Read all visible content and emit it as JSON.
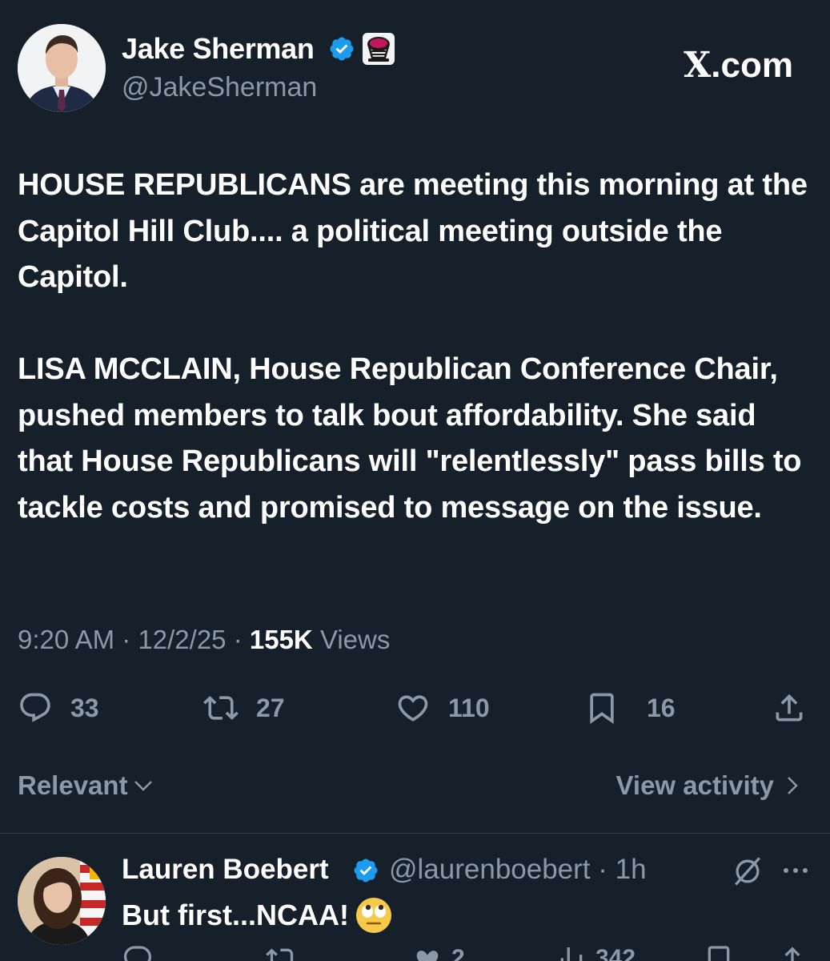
{
  "tweet": {
    "author_name": "Jake Sherman",
    "author_handle": "@JakeSherman",
    "brand": "X",
    "brand_suffix": ".com",
    "paragraphs": [
      "HOUSE REPUBLICANS are meeting this morning at the Capitol Hill Club.... a political meeting outside the Capitol.",
      "LISA MCCLAIN, House Republican Conference Chair, pushed members to talk bout affordability. She said that House Republicans will \"relentlessly\" pass bills to tackle costs and promised to message on the issue."
    ],
    "time": "9:20 AM",
    "date": "12/2/25",
    "views_count": "155K",
    "views_label": "Views",
    "separator": "·",
    "actions": {
      "replies": "33",
      "reposts": "27",
      "likes": "110",
      "bookmarks": "16"
    },
    "icons": {
      "reply": "reply-icon",
      "repost": "repost-icon",
      "like": "heart-icon",
      "bookmark": "bookmark-icon",
      "share": "share-icon",
      "verified": "verified-badge-icon"
    }
  },
  "filters": {
    "sort_label": "Relevant",
    "view_activity_label": "View activity"
  },
  "reply": {
    "author_name": "Lauren Boebert",
    "author_handle": "@laurenboebert",
    "time": "1h",
    "text": "But first...NCAA!",
    "emoji": "face-with-rolling-eyes",
    "actions": {
      "replies": "",
      "reposts": "",
      "likes": "2",
      "views": "342"
    }
  },
  "colors": {
    "background": "#15202b",
    "text_primary": "#ffffff",
    "text_secondary": "#8b98a5",
    "verified_blue": "#1d9bf0",
    "divider": "#2f3b47"
  }
}
